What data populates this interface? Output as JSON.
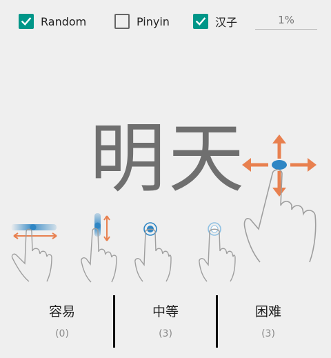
{
  "options": {
    "random": {
      "label": "Random",
      "checked": true
    },
    "pinyin": {
      "label": "Pinyin",
      "checked": false
    },
    "hanzi": {
      "label": "汉子",
      "checked": true
    },
    "progress_text": "1%"
  },
  "card": {
    "word": "明天"
  },
  "gestures": [
    "swipe-horizontal-icon",
    "swipe-vertical-icon",
    "tap-icon",
    "tap-light-icon",
    "drag-any-direction-icon"
  ],
  "answers": {
    "easy": {
      "label": "容易",
      "count": "(0)"
    },
    "medium": {
      "label": "中等",
      "count": "(3)"
    },
    "hard": {
      "label": "困难",
      "count": "(3)"
    }
  },
  "colors": {
    "accent": "#009688",
    "arrow": "#e8804f",
    "touch": "#2f86c4",
    "word": "#6f6f6f",
    "background": "#efefef"
  }
}
